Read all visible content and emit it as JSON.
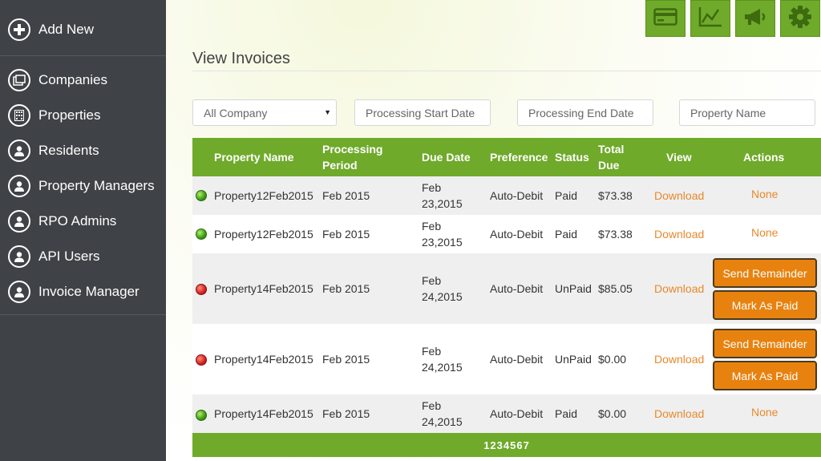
{
  "sidebar": {
    "add_new": "Add New",
    "items": [
      {
        "label": "Companies",
        "icon": "building-icon"
      },
      {
        "label": "Properties",
        "icon": "grid-building-icon"
      },
      {
        "label": "Residents",
        "icon": "user-icon"
      },
      {
        "label": "Property Managers",
        "icon": "user-icon"
      },
      {
        "label": "RPO Admins",
        "icon": "user-icon"
      },
      {
        "label": "API Users",
        "icon": "user-icon"
      },
      {
        "label": "Invoice Manager",
        "icon": "user-icon"
      }
    ]
  },
  "toolbar": {
    "icons": [
      "credit-card-icon",
      "line-chart-icon",
      "megaphone-icon",
      "gear-icon"
    ]
  },
  "page": {
    "title": "View Invoices"
  },
  "filters": {
    "company_select": "All Company",
    "start_date_placeholder": "Processing Start Date",
    "end_date_placeholder": "Processing End Date",
    "property_name_placeholder": "Property Name"
  },
  "table": {
    "headers": {
      "property_name": "Property Name",
      "processing_period_1": "Processing",
      "processing_period_2": "Period",
      "due_date": "Due Date",
      "preference": "Preference",
      "status": "Status",
      "total_due_1": "Total",
      "total_due_2": "Due",
      "view": "View",
      "actions": "Actions"
    },
    "rows": [
      {
        "status_color": "#3a9a12",
        "property": "Property12Feb2015",
        "period": "Feb 2015",
        "due_1": "Feb",
        "due_2": "23,2015",
        "preference": "Auto-Debit",
        "status": "Paid",
        "total": "$73.38",
        "view": "Download",
        "action": "None"
      },
      {
        "status_color": "#3a9a12",
        "property": "Property12Feb2015",
        "period": "Feb 2015",
        "due_1": "Feb",
        "due_2": "23,2015",
        "preference": "Auto-Debit",
        "status": "Paid",
        "total": "$73.38",
        "view": "Download",
        "action": "None"
      },
      {
        "status_color": "#d42020",
        "property": "Property14Feb2015",
        "period": "Feb 2015",
        "due_1": "Feb",
        "due_2": "24,2015",
        "preference": "Auto-Debit",
        "status": "UnPaid",
        "total": "$85.05",
        "view": "Download",
        "action_1": "Send Remainder",
        "action_2": "Mark As Paid"
      },
      {
        "status_color": "#d42020",
        "property": "Property14Feb2015",
        "period": "Feb 2015",
        "due_1": "Feb",
        "due_2": "24,2015",
        "preference": "Auto-Debit",
        "status": "UnPaid",
        "total": "$0.00",
        "view": "Download",
        "action_1": "Send Remainder",
        "action_2": "Mark As Paid"
      },
      {
        "status_color": "#3a9a12",
        "property": "Property14Feb2015",
        "period": "Feb 2015",
        "due_1": "Feb",
        "due_2": "24,2015",
        "preference": "Auto-Debit",
        "status": "Paid",
        "total": "$0.00",
        "view": "Download",
        "action": "None"
      }
    ]
  },
  "pager": {
    "pages": "1234567"
  },
  "colors": {
    "accent": "#6faa2a",
    "sidebar": "#3f4246",
    "link": "#e8892a",
    "button": "#e8820f"
  }
}
